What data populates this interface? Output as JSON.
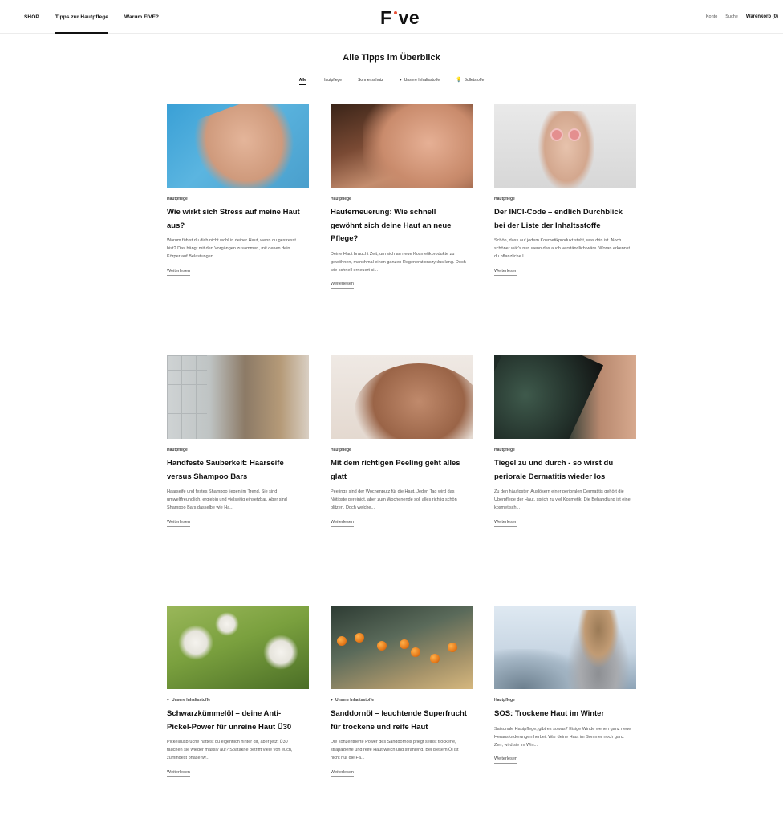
{
  "nav": {
    "left": [
      {
        "label": "SHOP"
      },
      {
        "label": "Tipps zur Hautpflege"
      },
      {
        "label": "Warum FIVE?"
      }
    ],
    "logo": "Five",
    "right": {
      "account": "Konto",
      "search": "Suche",
      "cart": "Warenkorb (0)"
    }
  },
  "page": {
    "title": "Alle Tipps im Überblick"
  },
  "filters": [
    {
      "label": "Alle",
      "icon": ""
    },
    {
      "label": "Hautpflege",
      "icon": ""
    },
    {
      "label": "Sonnenschutz",
      "icon": ""
    },
    {
      "label": "Unsere Inhaltsstoffe",
      "icon": "heart-icon"
    },
    {
      "label": "Bulletstoffe",
      "icon": "lightbulb-icon"
    }
  ],
  "read_more": "Weiterlesen",
  "articles": [
    {
      "category": "Hautpflege",
      "title": "Wie wirkt sich Stress auf meine Haut aus?",
      "excerpt": "Warum fühlst du dich nicht wohl in deiner Haut, wenn du gestresst bist? Das hängt mit den Vorgängen zusammen, mit denen dein Körper auf Belastungen..."
    },
    {
      "category": "Hautpflege",
      "title": "Hauterneuerung: Wie schnell gewöhnt sich deine Haut an neue Pflege?",
      "excerpt": "Deine Haut braucht Zeit, um sich an neue Kosmetikprodukte zu gewöhnen, manchmal einen ganzen Regenerationszyklus lang. Doch wie schnell erneuert si..."
    },
    {
      "category": "Hautpflege",
      "title": "Der INCI-Code – endlich Durchblick bei der Liste der Inhaltsstoffe",
      "excerpt": "Schön, dass auf jedem Kosmetikprodukt steht, was drin ist. Noch schöner wär's nur, wenn das auch verständlich wäre. Woran erkennst du pflanzliche I..."
    },
    {
      "category": "Hautpflege",
      "title": "Handfeste Sauberkeit: Haarseife versus Shampoo Bars",
      "excerpt": "Haarseife und festes Shampoo liegen im Trend. Sie sind umweltfreundlich, ergiebig und vielseitig einsetzbar. Aber sind Shampoo Bars dasselbe wie Ha..."
    },
    {
      "category": "Hautpflege",
      "title": "Mit dem richtigen Peeling geht alles glatt",
      "excerpt": "Peelings sind der Wochenputz für die Haut. Jeden Tag wird das Nötigste gereinigt, aber zum Wochenende soll alles richtig schön blitzen. Doch welche..."
    },
    {
      "category": "Hautpflege",
      "title": "Tiegel zu und durch - so wirst du periorale Dermatitis wieder los",
      "excerpt": "Zu den häufigsten Auslösern einer perioralen Dermatitis gehört die Überpflege der Haut, sprich zu viel Kosmetik. Die Behandlung ist eine kosmetisch..."
    },
    {
      "category": "Unsere Inhaltsstoffe",
      "title": "Schwarzkümmelöl – deine Anti-Pickel-Power für unreine Haut Ü30",
      "excerpt": "Pickelausbrüche hattest du eigentlich hinter dir, aber jetzt Ü30 tauchen sie wieder massiv auf? Spätakne betrifft viele von euch, zumindest phasenw..."
    },
    {
      "category": "Unsere Inhaltsstoffe",
      "title": "Sanddornöl – leuchtende Superfrucht für trockene und reife Haut",
      "excerpt": "Die konzentrierte Power des Sanddornöls pflegt selbst trockene, strapazierte und reife Haut weich und strahlend. Bei diesem Öl ist nicht nur die Fa..."
    },
    {
      "category": "Hautpflege",
      "title": "SOS: Trockene Haut im Winter",
      "excerpt": "Saisonale Hautpflege, gibt es sowas? Eisige Winde wehen ganz neue Herausforderungen herbei. War deine Haut im Sommer noch ganz Zen, wird sie im Win..."
    }
  ]
}
